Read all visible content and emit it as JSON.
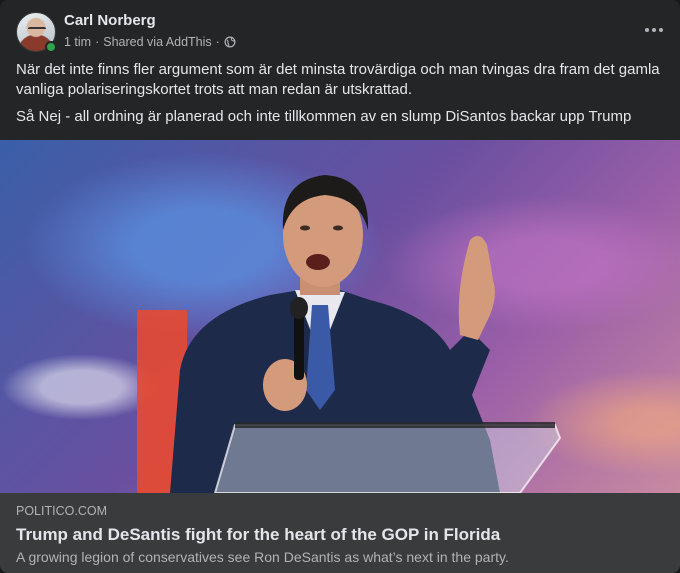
{
  "post": {
    "author": "Carl Norberg",
    "time": "1 tim",
    "separator": "·",
    "shared_via": "Shared via AddThis",
    "separator2": "·",
    "audience_icon": "globe-icon",
    "more_icon": "more-options-icon",
    "paragraphs": [
      "När det inte finns fler argument som är det minsta trovärdiga och man tvingas dra fram det gamla vanliga polariseringskortet trots att man redan är utskrattad.",
      "Så Nej - all ordning är planerad och inte tillkommen av en slump DiSantos backar upp Trump"
    ]
  },
  "link_preview": {
    "domain": "POLITICO.COM",
    "title": "Trump and DeSantis fight for the heart of the GOP in Florida",
    "description": "A growing legion of conservatives see Ron DeSantis as what’s next in the party."
  },
  "colors": {
    "card_bg": "#242526",
    "link_info_bg": "#3a3b3c",
    "text_primary": "#e4e6eb",
    "text_secondary": "#b0b3b8",
    "online": "#31a24c"
  }
}
